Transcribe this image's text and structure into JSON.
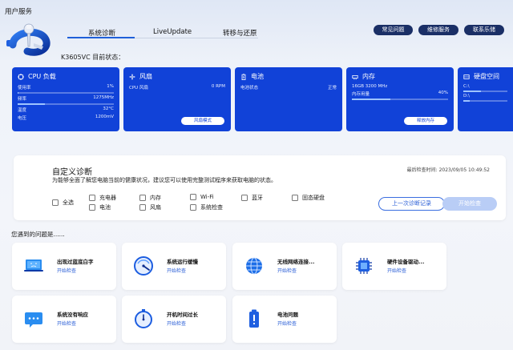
{
  "app": {
    "title": "用户服务"
  },
  "tabs": [
    {
      "label": "系统诊断"
    },
    {
      "label": "LiveUpdate"
    },
    {
      "label": "转移与还原"
    }
  ],
  "header_buttons": [
    {
      "label": "常见问题"
    },
    {
      "label": "维修服务"
    },
    {
      "label": "联系乐储"
    }
  ],
  "status": {
    "label": "K3605VC 目前状态："
  },
  "cards": {
    "cpu": {
      "title": "CPU 负载",
      "rows": [
        {
          "k": "使用率",
          "v": "1%"
        },
        {
          "k": "频率",
          "v": "1275MHz"
        },
        {
          "k": "温度",
          "v": "32°C"
        },
        {
          "k": "电压",
          "v": "1200mV"
        }
      ],
      "usage_fraction": 0.01,
      "freq_fraction": 0.28
    },
    "fan": {
      "title": "风扇",
      "rows": [
        {
          "k": "CPU 风扇",
          "v": "0 RPM"
        }
      ],
      "button": "风扇模式"
    },
    "battery": {
      "title": "电池",
      "rows": [
        {
          "k": "电池状态",
          "v": "正常"
        }
      ]
    },
    "memory": {
      "title": "内存",
      "rows": [
        {
          "k": "16GB 3200 MHz",
          "v": ""
        },
        {
          "k": "内存用量",
          "v": "40%"
        }
      ],
      "usage_fraction": 0.4,
      "button": "释放内存"
    },
    "disk": {
      "title": "硬盘空间",
      "rows": [
        {
          "k": "C:\\",
          "v": ""
        },
        {
          "k": "D:\\",
          "v": ""
        }
      ]
    }
  },
  "diagnose": {
    "title": "自定义诊断",
    "desc": "为能够全面了解您电脑当前的健康状况，建议您可以使用完整测试程序来获取电脑的状态。",
    "last_check_label": "最后检查时间:",
    "last_check_value": "2023/09/05 10:49:52",
    "select_all": "全选",
    "options": [
      "充电器",
      "电池",
      "内存",
      "风扇",
      "Wi-Fi",
      "系统检查",
      "蓝牙",
      "固态硬盘"
    ],
    "history_button": "上一次诊断记录",
    "start_button": "开始检查"
  },
  "problems": {
    "label": "您遇到的问题是......",
    "items": [
      {
        "title": "出现过蓝底白字",
        "link": "开始检查",
        "icon": "bluescreen-laptop-icon"
      },
      {
        "title": "系统运行缓慢",
        "link": "开始检查",
        "icon": "speedometer-icon"
      },
      {
        "title": "无线网络连接...",
        "link": "开始检查",
        "icon": "globe-icon"
      },
      {
        "title": "硬件设备驱动...",
        "link": "开始检查",
        "icon": "chip-icon"
      },
      {
        "title": "系统没有响应",
        "link": "开始检查",
        "icon": "chat-dots-icon"
      },
      {
        "title": "开机时间过长",
        "link": "开始检查",
        "icon": "timer-icon"
      },
      {
        "title": "电池问题",
        "link": "开始检查",
        "icon": "battery-alert-icon"
      }
    ]
  },
  "colors": {
    "accent": "#1142d8",
    "link": "#2a5ed6",
    "pill": "#1a2f66"
  }
}
